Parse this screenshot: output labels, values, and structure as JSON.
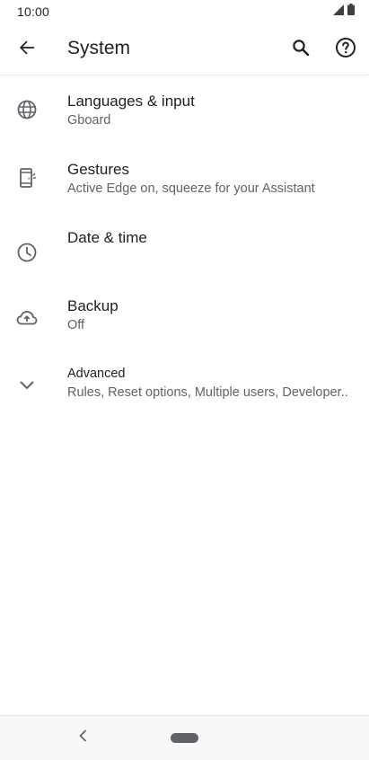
{
  "status_bar": {
    "time": "10:00",
    "icons": [
      "signal-icon",
      "battery-icon"
    ]
  },
  "app_bar": {
    "title": "System",
    "back_icon": "arrow-back-icon",
    "search_icon": "search-icon",
    "help_icon": "help-icon"
  },
  "items": [
    {
      "title": "Languages & input",
      "subtitle": "Gboard",
      "icon": "globe-icon"
    },
    {
      "title": "Gestures",
      "subtitle": "Active Edge on, squeeze for your Assistant",
      "icon": "phone-gesture-icon"
    },
    {
      "title": "Date & time",
      "subtitle": "",
      "icon": "clock-icon"
    },
    {
      "title": "Backup",
      "subtitle": "Off",
      "icon": "cloud-upload-icon"
    },
    {
      "title": "Advanced",
      "subtitle": "Rules, Reset options, Multiple users, Developer..",
      "icon": "chevron-down-icon"
    }
  ],
  "nav_bar": {
    "back_icon": "nav-back-icon",
    "home_icon": "nav-home-pill"
  },
  "colors": {
    "text_primary": "#202124",
    "text_secondary": "#5f6368",
    "icon": "#5f6368",
    "background": "#ffffff"
  }
}
